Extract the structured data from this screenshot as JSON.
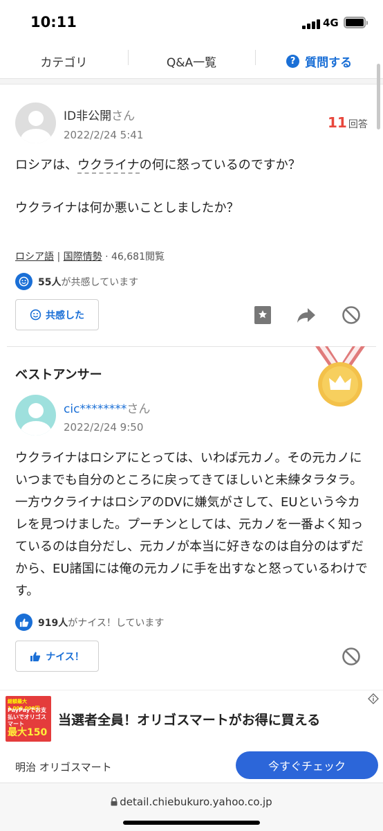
{
  "status": {
    "time": "10:11",
    "network": "4G"
  },
  "nav": {
    "category": "カテゴリ",
    "qa_list": "Q&A一覧",
    "ask": "質問する",
    "ask_icon": "?"
  },
  "question": {
    "user": "ID非公開",
    "san": "さん",
    "date": "2022/2/24 5:41",
    "answer_count": "11",
    "answer_label": "回答",
    "line1_a": "ロシアは、",
    "line1_link": "ウクライナ",
    "line1_b": "の何に怒っているのですか？",
    "line2": "ウクライナは何か悪いことしましたか？",
    "tag1": "ロシア語",
    "tag2": "国際情勢",
    "views": "46,681閲覧",
    "empathy_count": "55人",
    "empathy_text": "が共感しています",
    "empathy_button": "共感した"
  },
  "best_answer": {
    "title": "ベストアンサー",
    "user": "cic********",
    "san": "さん",
    "date": "2022/2/24 9:50",
    "text": "ウクライナはロシアにとっては、いわば元カノ。その元カノにいつまでも自分のところに戻ってきてほしいと未練タラタラ。一方ウクライナはロシアのDVに嫌気がさして、EUという今カレを見つけました。プーチンとしては、元カノを一番よく知っているのは自分だし、元カノが本当に好きなのは自分のはずだから、EU諸国には俺の元カノに手を出すなと怒っているわけです。",
    "nice_count": "919人",
    "nice_text": "がナイス！しています",
    "nice_button": "ナイス！"
  },
  "ad": {
    "thumb_line1": "総額最大1,000,000円",
    "thumb_line2": "PayPayでお支払いでオリゴスマート",
    "thumb_line3": "最大150",
    "headline": "当選者全員！オリゴスマートがお得に買える",
    "sponsor": "明治 オリゴスマート",
    "cta": "今すぐチェック"
  },
  "url": "detail.chiebukuro.yahoo.co.jp",
  "colors": {
    "accent": "#1a6fd6",
    "answer_count": "#e8473c",
    "cta": "#2c66d9"
  }
}
